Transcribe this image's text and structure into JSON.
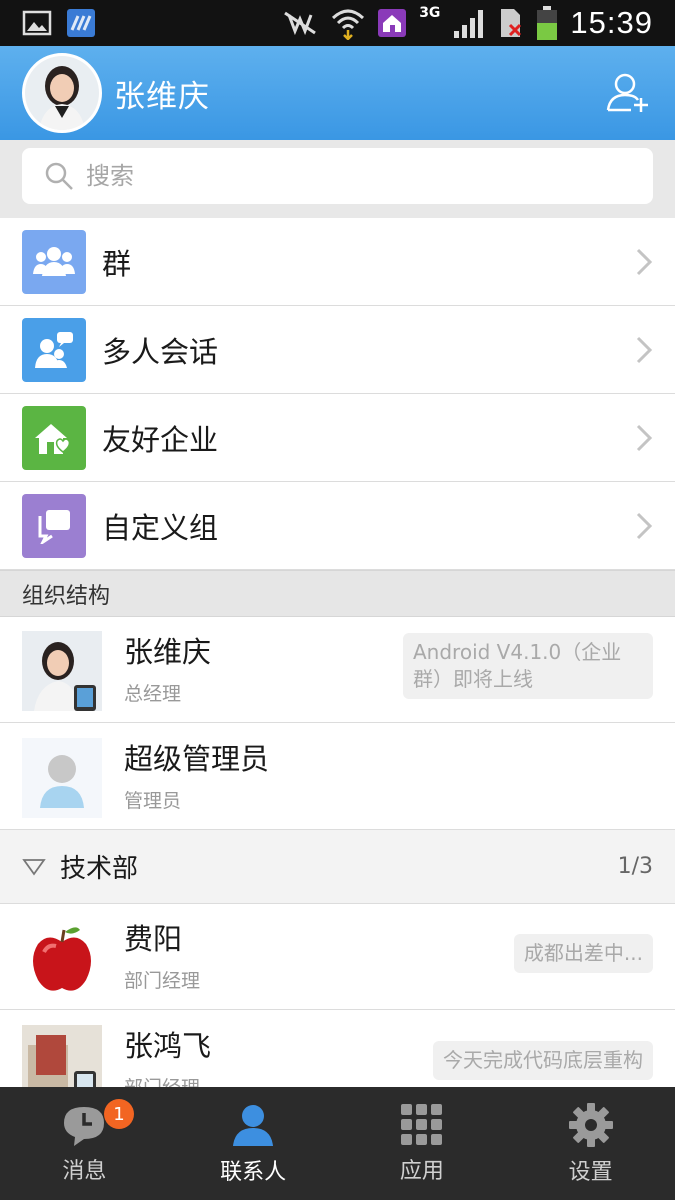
{
  "status_bar": {
    "time": "15:39",
    "network": "3G"
  },
  "header": {
    "user_name": "张维庆"
  },
  "search": {
    "placeholder": "搜索"
  },
  "entries": [
    {
      "label": "群",
      "color": "#7aa8f0",
      "icon": "group-icon"
    },
    {
      "label": "多人会话",
      "color": "#4a9fe8",
      "icon": "multi-chat-icon"
    },
    {
      "label": "友好企业",
      "color": "#5bb543",
      "icon": "friendly-company-icon"
    },
    {
      "label": "自定义组",
      "color": "#9b7fd1",
      "icon": "custom-group-icon"
    }
  ],
  "section": {
    "title": "组织结构"
  },
  "contacts": [
    {
      "name": "张维庆",
      "role": "总经理",
      "status": "Android V4.1.0（企业群）即将上线"
    },
    {
      "name": "超级管理员",
      "role": "管理员",
      "status": ""
    }
  ],
  "department": {
    "name": "技术部",
    "count": "1/3"
  },
  "dept_contacts": [
    {
      "name": "费阳",
      "role": "部门经理",
      "status": "成都出差中..."
    },
    {
      "name": "张鸿飞",
      "role": "部门经理",
      "status": "今天完成代码底层重构"
    }
  ],
  "tabs": [
    {
      "label": "消息",
      "badge": "1"
    },
    {
      "label": "联系人"
    },
    {
      "label": "应用"
    },
    {
      "label": "设置"
    }
  ],
  "colors": {
    "accent": "#3a97e4",
    "tab_active": "#3d8fe0",
    "badge": "#f26522"
  }
}
